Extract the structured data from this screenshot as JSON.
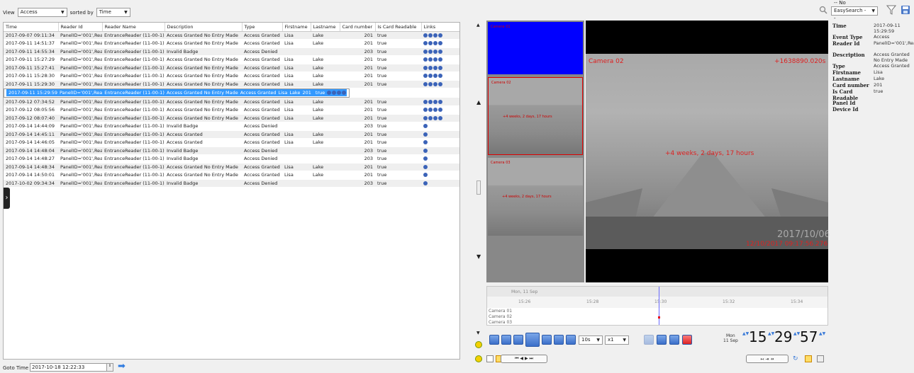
{
  "toolbar": {
    "view_label": "View",
    "view_value": "Access",
    "sorted_label": "sorted by",
    "sorted_value": "Time",
    "easysearch_value": "-- No EasySearch --"
  },
  "table": {
    "columns": [
      "Time",
      "Reader Id",
      "Reader Name",
      "Description",
      "Type",
      "Firstname",
      "Lastname",
      "Card number",
      "Is Card Readable",
      "Links"
    ],
    "rows": [
      {
        "time": "2017-09-07 09:11:34",
        "reader_id": "PanelID='001',Rea",
        "reader_name": "EntranceReader (11-00-1)",
        "description": "Access Granted No Entry Made",
        "type": "Access Granted",
        "first": "Lisa",
        "last": "Lake",
        "card": "201",
        "readable": "true",
        "links": 4
      },
      {
        "time": "2017-09-11 14:51:37",
        "reader_id": "PanelID='001',Rea",
        "reader_name": "EntranceReader (11-00-1)",
        "description": "Access Granted No Entry Made",
        "type": "Access Granted",
        "first": "Lisa",
        "last": "Lake",
        "card": "201",
        "readable": "true",
        "links": 4
      },
      {
        "time": "2017-09-11 14:55:34",
        "reader_id": "PanelID='001',Rea",
        "reader_name": "EntranceReader (11-00-1)",
        "description": "Invalid Badge",
        "type": "Access Denied",
        "first": "",
        "last": "",
        "card": "203",
        "readable": "true",
        "links": 4
      },
      {
        "time": "2017-09-11 15:27:29",
        "reader_id": "PanelID='001',Rea",
        "reader_name": "EntranceReader (11-00-1)",
        "description": "Access Granted No Entry Made",
        "type": "Access Granted",
        "first": "Lisa",
        "last": "Lake",
        "card": "201",
        "readable": "true",
        "links": 4
      },
      {
        "time": "2017-09-11 15:27:41",
        "reader_id": "PanelID='001',Rea",
        "reader_name": "EntranceReader (11-00-1)",
        "description": "Access Granted No Entry Made",
        "type": "Access Granted",
        "first": "Lisa",
        "last": "Lake",
        "card": "201",
        "readable": "true",
        "links": 4
      },
      {
        "time": "2017-09-11 15:28:30",
        "reader_id": "PanelID='001',Rea",
        "reader_name": "EntranceReader (11-00-1)",
        "description": "Access Granted No Entry Made",
        "type": "Access Granted",
        "first": "Lisa",
        "last": "Lake",
        "card": "201",
        "readable": "true",
        "links": 4
      },
      {
        "time": "2017-09-11 15:29:30",
        "reader_id": "PanelID='001',Rea",
        "reader_name": "EntranceReader (11-00-1)",
        "description": "Access Granted No Entry Made",
        "type": "Access Granted",
        "first": "Lisa",
        "last": "Lake",
        "card": "201",
        "readable": "true",
        "links": 4
      },
      {
        "time": "2017-09-11 15:29:59",
        "reader_id": "PanelID='001',Rea",
        "reader_name": "EntranceReader (11-00-1)",
        "description": "Access Granted No Entry Made",
        "type": "Access Granted",
        "first": "Lisa",
        "last": "Lake",
        "card": "201",
        "readable": "true",
        "links": 4
      },
      {
        "time": "2017-09-12 07:34:52",
        "reader_id": "PanelID='001',Rea",
        "reader_name": "EntranceReader (11-00-1)",
        "description": "Access Granted No Entry Made",
        "type": "Access Granted",
        "first": "Lisa",
        "last": "Lake",
        "card": "201",
        "readable": "true",
        "links": 4
      },
      {
        "time": "2017-09-12 08:05:56",
        "reader_id": "PanelID='001',Rea",
        "reader_name": "EntranceReader (11-00-1)",
        "description": "Access Granted No Entry Made",
        "type": "Access Granted",
        "first": "Lisa",
        "last": "Lake",
        "card": "201",
        "readable": "true",
        "links": 4
      },
      {
        "time": "2017-09-12 08:07:40",
        "reader_id": "PanelID='001',Rea",
        "reader_name": "EntranceReader (11-00-1)",
        "description": "Access Granted No Entry Made",
        "type": "Access Granted",
        "first": "Lisa",
        "last": "Lake",
        "card": "201",
        "readable": "true",
        "links": 4
      },
      {
        "time": "2017-09-14 14:44:09",
        "reader_id": "PanelID='001',Rea",
        "reader_name": "EntranceReader (11-00-1)",
        "description": "Invalid Badge",
        "type": "Access Denied",
        "first": "",
        "last": "",
        "card": "203",
        "readable": "true",
        "links": 1
      },
      {
        "time": "2017-09-14 14:45:11",
        "reader_id": "PanelID='001',Rea",
        "reader_name": "EntranceReader (11-00-1)",
        "description": "Access Granted",
        "type": "Access Granted",
        "first": "Lisa",
        "last": "Lake",
        "card": "201",
        "readable": "true",
        "links": 1
      },
      {
        "time": "2017-09-14 14:46:05",
        "reader_id": "PanelID='001',Rea",
        "reader_name": "EntranceReader (11-00-1)",
        "description": "Access Granted",
        "type": "Access Granted",
        "first": "Lisa",
        "last": "Lake",
        "card": "201",
        "readable": "true",
        "links": 1
      },
      {
        "time": "2017-09-14 14:48:04",
        "reader_id": "PanelID='001',Rea",
        "reader_name": "EntranceReader (11-00-1)",
        "description": "Invalid Badge",
        "type": "Access Denied",
        "first": "",
        "last": "",
        "card": "203",
        "readable": "true",
        "links": 1
      },
      {
        "time": "2017-09-14 14:48:27",
        "reader_id": "PanelID='001',Rea",
        "reader_name": "EntranceReader (11-00-1)",
        "description": "Invalid Badge",
        "type": "Access Denied",
        "first": "",
        "last": "",
        "card": "203",
        "readable": "true",
        "links": 1
      },
      {
        "time": "2017-09-14 14:48:34",
        "reader_id": "PanelID='001',Rea",
        "reader_name": "EntranceReader (11-00-1)",
        "description": "Access Granted No Entry Made",
        "type": "Access Granted",
        "first": "Lisa",
        "last": "Lake",
        "card": "201",
        "readable": "true",
        "links": 1
      },
      {
        "time": "2017-09-14 14:50:01",
        "reader_id": "PanelID='001',Rea",
        "reader_name": "EntranceReader (11-00-1)",
        "description": "Access Granted No Entry Made",
        "type": "Access Granted",
        "first": "Lisa",
        "last": "Lake",
        "card": "201",
        "readable": "true",
        "links": 1
      },
      {
        "time": "2017-10-02 09:34:34",
        "reader_id": "PanelID='001',Rea",
        "reader_name": "EntranceReader (11-00-1)",
        "description": "Invalid Badge",
        "type": "Access Denied",
        "first": "",
        "last": "",
        "card": "203",
        "readable": "true",
        "links": 1
      }
    ],
    "selected_row": 7
  },
  "video": {
    "thumb1_label": "Camera 01",
    "thumb2_label": "Camera 02",
    "thumb2_age": "+4 weeks, 2 days, 17 hours",
    "thumb3_label": "Camera 03",
    "thumb3_age": "+4 weeks, 2 days, 17 hours",
    "main_label": "Camera 02",
    "main_offset": "+1638890.020s",
    "main_age": "+4 weeks, 2 days, 17 hours",
    "main_stamp_date": "2017/10/06",
    "main_timestamp": "12/10/2017 09:17:56.276"
  },
  "timeline": {
    "day": "Mon, 11 Sep",
    "ticks": [
      "15:26",
      "15:28",
      "15:30",
      "15:32",
      "15:34"
    ],
    "tracks": [
      "Camera 01",
      "Camera 02",
      "Camera 03"
    ]
  },
  "controls": {
    "interval": "10s",
    "speed": "x1",
    "clock_day": "Mon",
    "clock_date": "11 Sep",
    "hh": "15",
    "mm": "29",
    "ss": "57"
  },
  "props": [
    {
      "k": "Time",
      "v": "2017-09-11 15:29:59"
    },
    {
      "k": "Event Type",
      "v": "Access"
    },
    {
      "k": "Reader Id",
      "v": "PanelID='001',ReaderID='001'"
    },
    {
      "k": "Description",
      "v": "Access Granted No Entry Made"
    },
    {
      "k": "Type",
      "v": "Access Granted"
    },
    {
      "k": "Firstname",
      "v": "Lisa"
    },
    {
      "k": "Lastname",
      "v": "Lake"
    },
    {
      "k": "Card number",
      "v": "201"
    },
    {
      "k": "Is Card Readable",
      "v": "true"
    },
    {
      "k": "Panel Id",
      "v": ""
    },
    {
      "k": "Device Id",
      "v": ""
    }
  ],
  "footer": {
    "goto_label": "Goto Time",
    "goto_value": "2017-10-18 12:22:33"
  }
}
